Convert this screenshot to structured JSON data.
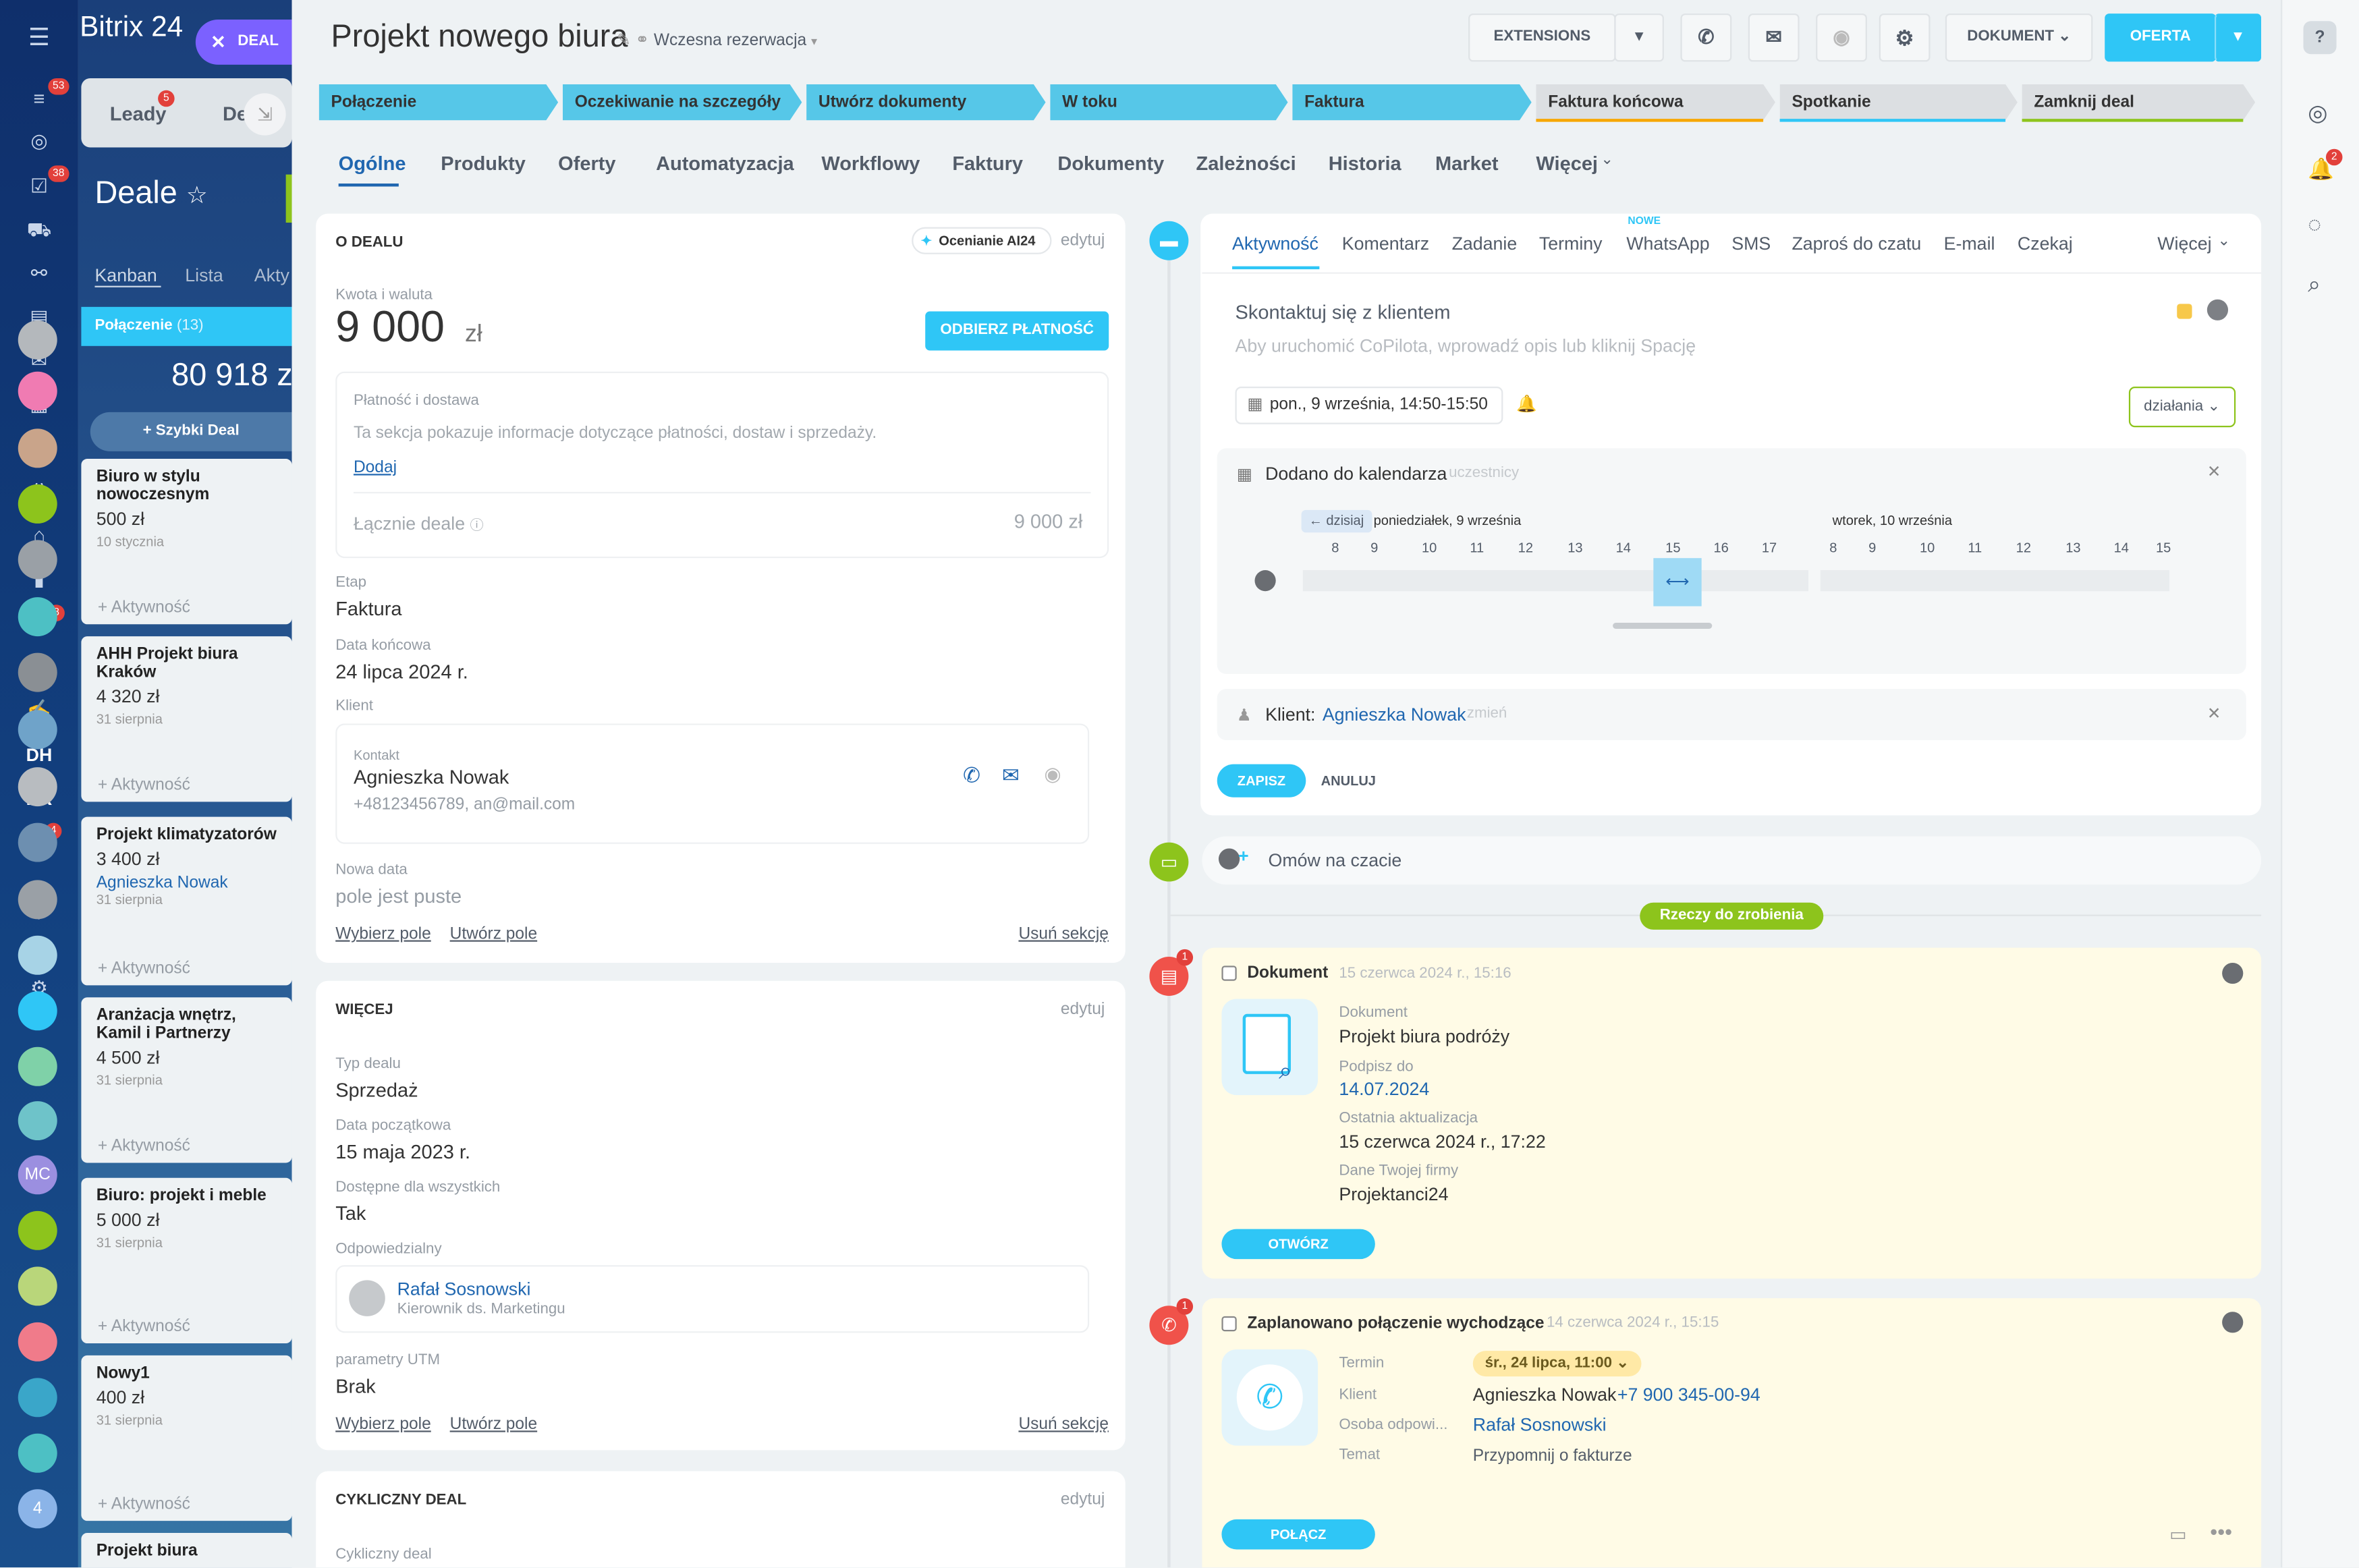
{
  "app": {
    "brand": "Bitrix 24",
    "close_chip": "DEAL"
  },
  "rail": {
    "badges": [
      "53",
      "38",
      "8",
      "4"
    ]
  },
  "behind": {
    "tabs": [
      "Leady",
      "De"
    ],
    "leads_badge": "5",
    "title": "Deale",
    "views": [
      "Kanban",
      "Lista",
      "Akty"
    ],
    "column": "Połączenie",
    "column_count": "(13)",
    "sum": "80 918 z",
    "quick": "+ Szybki Deal",
    "cards": [
      {
        "title": "Biuro w stylu nowoczesnym",
        "amount": "500 zł",
        "date": "10 stycznia",
        "act": "+ Aktywność"
      },
      {
        "title": "AHH Projekt biura Kraków",
        "amount": "4 320 zł",
        "date": "31 sierpnia",
        "act": "+ Aktywność"
      },
      {
        "title": "Projekt klimatyzatorów",
        "amount": "3 400 zł",
        "person": "Agnieszka Nowak",
        "date": "31 sierpnia",
        "act": "+ Aktywność"
      },
      {
        "title": "Aranżacja wnętrz, Kamil i Partnerzy",
        "amount": "4 500 zł",
        "date": "31 sierpnia",
        "act": "+ Aktywność"
      },
      {
        "title": "Biuro: projekt i meble",
        "amount": "5 000 zł",
        "date": "31 sierpnia",
        "act": "+ Aktywność"
      },
      {
        "title": "Nowy1",
        "amount": "400 zł",
        "date": "31 sierpnia",
        "act": "+ Aktywność"
      },
      {
        "title": "Projekt biura"
      }
    ]
  },
  "header": {
    "title": "Projekt nowego biura",
    "subtitle": "Wczesna rezerwacja",
    "extensions": "EXTENSIONS",
    "document": "DOKUMENT",
    "offer": "OFERTA"
  },
  "stages": [
    "Połączenie",
    "Oczekiwanie na szczegóły",
    "Utwórz dokumenty",
    "W toku",
    "Faktura",
    "Faktura końcowa",
    "Spotkanie",
    "Zamknij deal"
  ],
  "colors": {
    "active_stage": "#56c7e8",
    "inactive_stage": "#dcdfe2",
    "accent": "#2fc6f6",
    "green": "#8dc41c",
    "red": "#f0524a",
    "yellow_bg": "#fffbe6"
  },
  "tabs": [
    "Ogólne",
    "Produkty",
    "Oferty",
    "Automatyzacja",
    "Workflowy",
    "Faktury",
    "Dokumenty",
    "Zależności",
    "Historia",
    "Market",
    "Więcej"
  ],
  "about": {
    "heading": "O DEALU",
    "ai": "Ocenianie AI24",
    "edit": "edytuj",
    "amount_label": "Kwota i waluta",
    "amount": "9 000",
    "currency": "zł",
    "pay_button": "ODBIERZ PŁATNOŚĆ",
    "payment_title": "Płatność i dostawa",
    "payment_desc": "Ta sekcja pokazuje informacje dotyczące płatności, dostaw i sprzedaży.",
    "add": "Dodaj",
    "total_label": "Łącznie deale",
    "total_value": "9 000 zł",
    "stage_label": "Etap",
    "stage_value": "Faktura",
    "end_label": "Data końcowa",
    "end_value": "24 lipca 2024 r.",
    "client_label": "Klient",
    "contact_label": "Kontakt",
    "contact_name": "Agnieszka Nowak",
    "contact_info": "+48123456789, an@mail.com",
    "new_label": "Nowa data",
    "new_value": "pole jest puste",
    "choose": "Wybierz pole",
    "create": "Utwórz pole",
    "remove": "Usuń sekcję"
  },
  "more": {
    "heading": "WIĘCEJ",
    "edit": "edytuj",
    "type_label": "Typ dealu",
    "type_value": "Sprzedaż",
    "start_label": "Data początkowa",
    "start_value": "15 maja 2023 r.",
    "avail_label": "Dostępne dla wszystkich",
    "avail_value": "Tak",
    "resp_label": "Odpowiedzialny",
    "resp_name": "Rafał Sosnowski",
    "resp_role": "Kierownik ds. Marketingu",
    "utm_label": "parametry UTM",
    "utm_value": "Brak",
    "choose": "Wybierz pole",
    "create": "Utwórz pole",
    "remove": "Usuń sekcję"
  },
  "cyclic": {
    "heading": "CYKLICZNY DEAL",
    "edit": "edytuj",
    "label": "Cykliczny deal"
  },
  "activity": {
    "tabs": [
      "Aktywność",
      "Komentarz",
      "Zadanie",
      "Terminy",
      "WhatsApp",
      "SMS",
      "Zaproś do czatu",
      "E-mail",
      "Czekaj",
      "Więcej"
    ],
    "new_badge": "NOWE",
    "title": "Skontaktuj się z klientem",
    "hint": "Aby uruchomić CoPilota, wprowadź opis lub kliknij Spację",
    "date": "pon., 9 września, 14:50-15:50",
    "actions": "działania",
    "cal_title": "Dodano do kalendarza",
    "cal_part": "uczestnicy",
    "today": "← dzisiaj",
    "day1": "poniedziałek, 9 września",
    "day2": "wtorek, 10 września",
    "hours1": [
      "8",
      "9",
      "10",
      "11",
      "12",
      "13",
      "14",
      "15",
      "16",
      "17"
    ],
    "hours2": [
      "8",
      "9",
      "10",
      "11",
      "12",
      "13",
      "14",
      "15"
    ],
    "client_label": "Klient:",
    "client_name": "Agnieszka Nowak",
    "change": "zmień",
    "save": "ZAPISZ",
    "cancel": "ANULUJ"
  },
  "chat": "Omów na czacie",
  "todo": "Rzeczy do zrobienia",
  "doc": {
    "title": "Dokument",
    "time": "15 czerwca 2024 r., 15:16",
    "badge": "1",
    "l1": "Dokument",
    "v1": "Projekt biura podróży",
    "l2": "Podpisz do",
    "v2": "14.07.2024",
    "l3": "Ostatnia aktualizacja",
    "v3": "15 czerwca 2024 r., 17:22",
    "l4": "Dane Twojej firmy",
    "v4": "Projektanci24",
    "open": "OTWÓRZ"
  },
  "call": {
    "title": "Zaplanowano połączenie wychodzące",
    "time": "14 czerwca 2024 r., 15:15",
    "badge": "1",
    "l1": "Termin",
    "v1": "śr., 24 lipca, 11:00",
    "l2": "Klient",
    "v2a": "Agnieszka Nowak",
    "v2b": "+7 900 345-00-94",
    "l3": "Osoba odpowi...",
    "v3": "Rafał Sosnowski",
    "l4": "Temat",
    "v4": "Przypomnij o fakturze",
    "connect": "POŁĄCZ"
  },
  "right": {
    "bell_badge": "2",
    "mc": "MC",
    "count": "4"
  }
}
